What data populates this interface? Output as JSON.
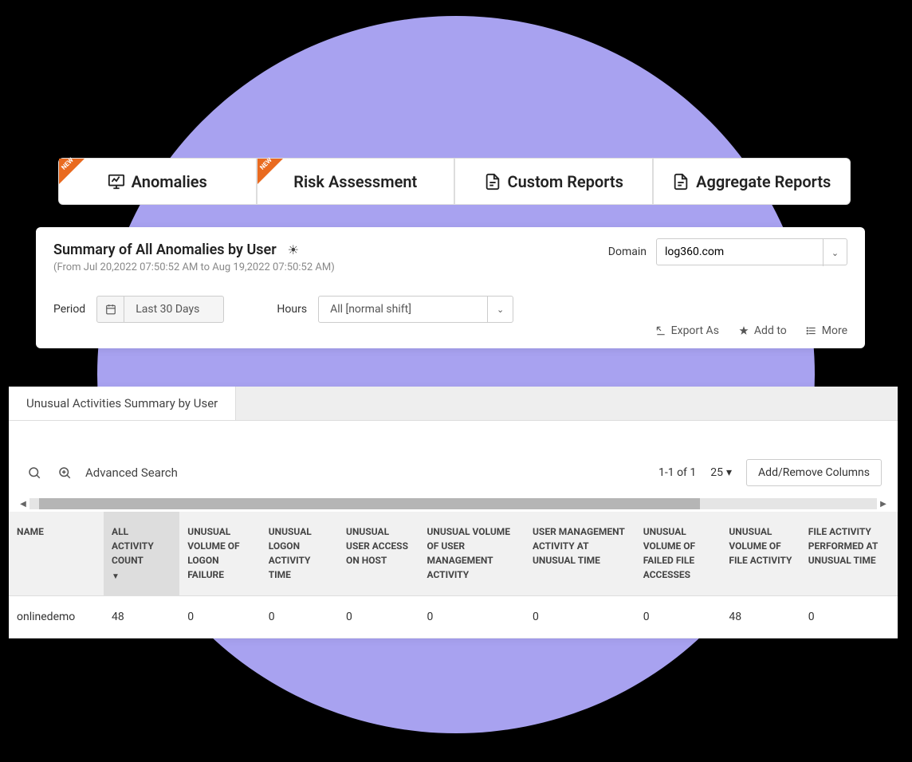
{
  "tabs": [
    {
      "label": "Anomalies",
      "new": true
    },
    {
      "label": "Risk Assessment",
      "new": true
    },
    {
      "label": "Custom Reports",
      "new": false
    },
    {
      "label": "Aggregate Reports",
      "new": false
    }
  ],
  "new_badge_text": "NEW",
  "summary": {
    "title": "Summary of All Anomalies by User",
    "subtitle": "(From Jul 20,2022 07:50:52 AM to Aug 19,2022 07:50:52 AM)",
    "domain_label": "Domain",
    "domain_value": "log360.com",
    "period_label": "Period",
    "period_value": "Last 30 Days",
    "hours_label": "Hours",
    "hours_value": "All [normal shift]"
  },
  "actions": {
    "export": "Export As",
    "addto": "Add to",
    "more": "More"
  },
  "panel": {
    "tab": "Unusual Activities Summary by User",
    "advanced_search": "Advanced Search",
    "pagination": "1-1 of 1",
    "page_size": "25",
    "columns_btn": "Add/Remove Columns"
  },
  "columns": [
    "NAME",
    "ALL ACTIVITY COUNT",
    "UNUSUAL VOLUME OF LOGON FAILURE",
    "UNUSUAL LOGON ACTIVITY TIME",
    "UNUSUAL USER ACCESS ON HOST",
    "UNUSUAL VOLUME OF USER MANAGEMENT ACTIVITY",
    "USER MANAGEMENT ACTIVITY AT UNUSUAL TIME",
    "UNUSUAL VOLUME OF FAILED FILE ACCESSES",
    "UNUSUAL VOLUME OF FILE ACTIVITY",
    "FILE ACTIVITY PERFORMED AT UNUSUAL TIME"
  ],
  "rows": [
    {
      "c0": "onlinedemo",
      "c1": "48",
      "c2": "0",
      "c3": "0",
      "c4": "0",
      "c5": "0",
      "c6": "0",
      "c7": "0",
      "c8": "48",
      "c9": "0"
    }
  ]
}
